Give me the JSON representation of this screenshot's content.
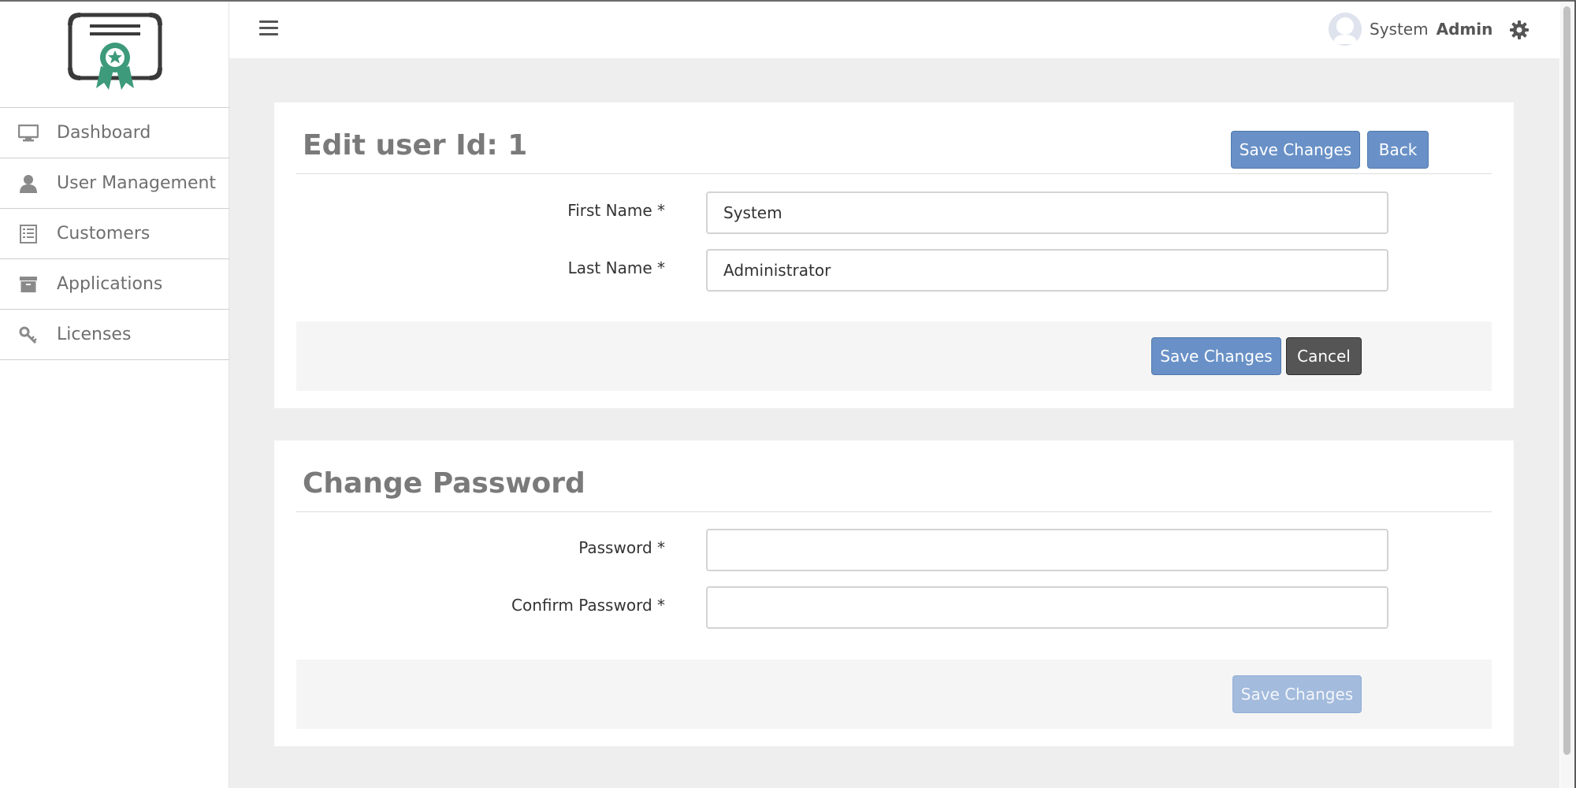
{
  "sidebar": {
    "items": [
      {
        "label": "Dashboard",
        "icon": "monitor-icon"
      },
      {
        "label": "User Management",
        "icon": "user-icon"
      },
      {
        "label": "Customers",
        "icon": "list-icon"
      },
      {
        "label": "Applications",
        "icon": "archive-icon"
      },
      {
        "label": "Licenses",
        "icon": "key-icon"
      }
    ]
  },
  "header": {
    "user_first": "System",
    "user_last": "Admin"
  },
  "edit_user": {
    "title": "Edit user Id: 1",
    "save_label": "Save Changes",
    "back_label": "Back",
    "first_name_label": "First Name *",
    "first_name_value": "System",
    "last_name_label": "Last Name *",
    "last_name_value": "Administrator",
    "footer_save_label": "Save Changes",
    "cancel_label": "Cancel"
  },
  "change_password": {
    "title": "Change Password",
    "password_label": "Password *",
    "password_value": "",
    "confirm_label": "Confirm Password *",
    "confirm_value": "",
    "save_label": "Save Changes"
  },
  "colors": {
    "primary": "#6991c7",
    "dark_button": "#555555",
    "disabled_button": "#a3bbdc",
    "logo_green": "#3d9a7a",
    "logo_dark": "#3a3a3a"
  }
}
